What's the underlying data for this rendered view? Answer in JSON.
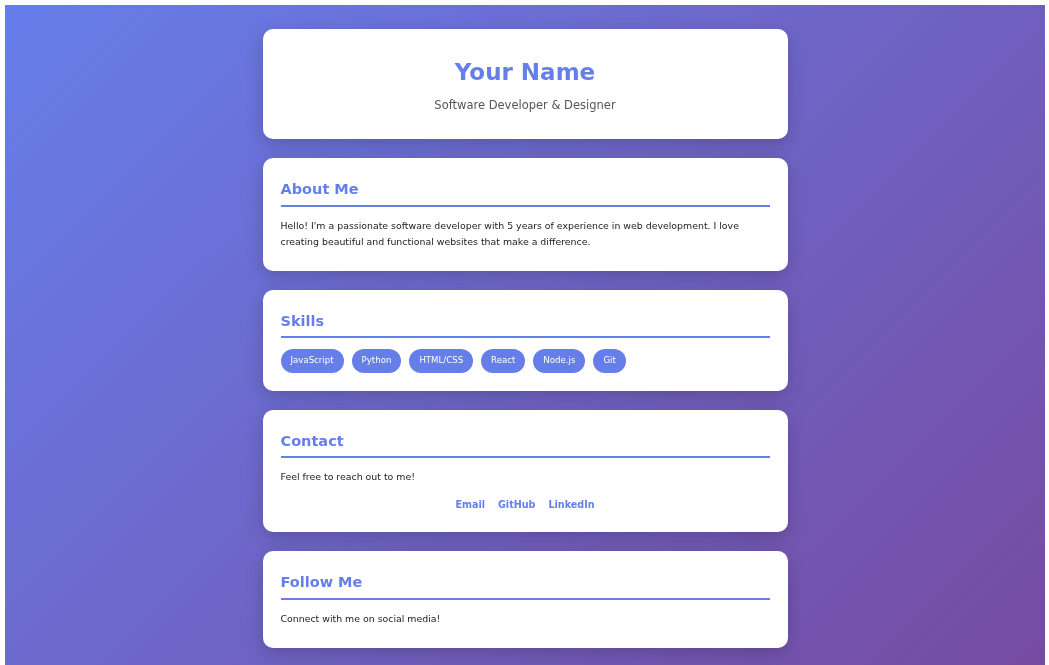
{
  "header": {
    "name": "Your Name",
    "tagline": "Software Developer & Designer"
  },
  "sections": [
    {
      "kind": "text",
      "title": "About Me",
      "text": "Hello! I'm a passionate software developer with 5 years of experience in web development. I love creating beautiful and functional websites that make a difference."
    },
    {
      "kind": "skills",
      "title": "Skills",
      "skills": [
        "JavaScript",
        "Python",
        "HTML/CSS",
        "React",
        "Node.js",
        "Git"
      ]
    },
    {
      "kind": "contact",
      "title": "Contact",
      "text": "Feel free to reach out to me!",
      "links": [
        "Email",
        "GitHub",
        "LinkedIn"
      ]
    },
    {
      "kind": "text",
      "title": "Follow Me",
      "text": "Connect with me on social media!"
    }
  ]
}
